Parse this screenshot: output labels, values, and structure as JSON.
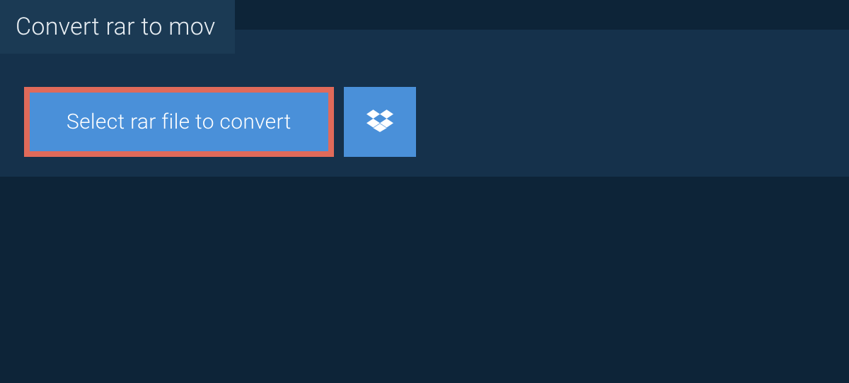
{
  "tab": {
    "title": "Convert rar to mov"
  },
  "actions": {
    "select_label": "Select rar file to convert"
  }
}
